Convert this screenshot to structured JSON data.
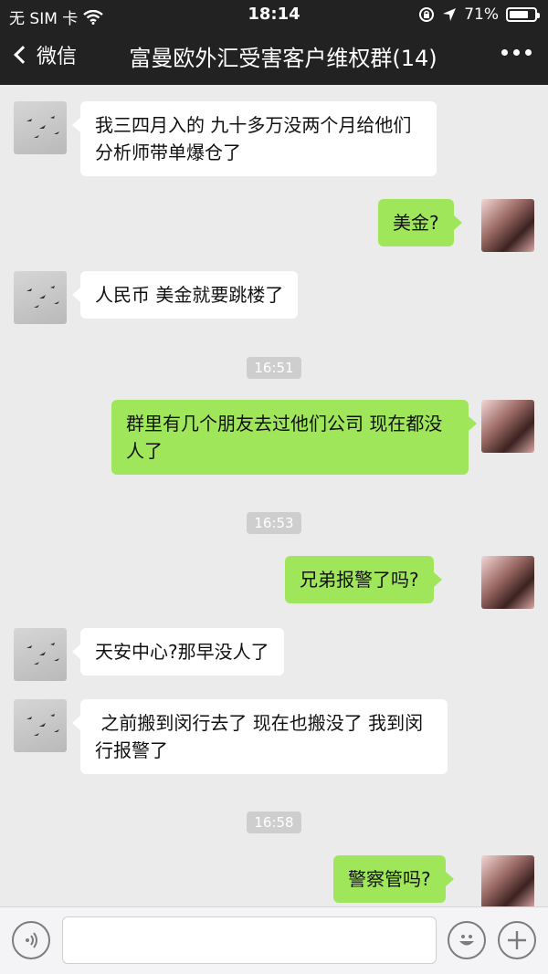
{
  "status_bar": {
    "carrier": "无 SIM 卡",
    "time": "18:14",
    "battery": "71%",
    "icons": [
      "wifi-icon",
      "rotation-lock-icon",
      "location-icon",
      "battery-icon"
    ]
  },
  "nav": {
    "back_label": "微信",
    "title": "富曼欧外汇受害客户维权群(14)"
  },
  "messages": [
    {
      "text": "我三四月入的 九十多万没两个月给他们分析师带单爆仓了"
    },
    {
      "text": "美金?"
    },
    {
      "text": "人民币 美金就要跳楼了"
    },
    {
      "time": "16:51"
    },
    {
      "text": "群里有几个朋友去过他们公司 现在都没人了"
    },
    {
      "time": "16:53"
    },
    {
      "text": "兄弟报警了吗?"
    },
    {
      "text": "天安中心?那早没人了"
    },
    {
      "text": " 之前搬到闵行去了 现在也搬没了 我到闵行报警了"
    },
    {
      "time": "16:58"
    },
    {
      "text": "警察管吗?"
    }
  ],
  "input_bar": {
    "icons": [
      "voice-icon",
      "emoji-icon",
      "plus-icon"
    ],
    "placeholder": ""
  },
  "colors": {
    "nav_bg": "#232223",
    "chat_bg": "#ebebeb",
    "outgoing_bubble": "#9fe65b",
    "incoming_bubble": "#ffffff",
    "timestamp_bg": "#cecece"
  }
}
